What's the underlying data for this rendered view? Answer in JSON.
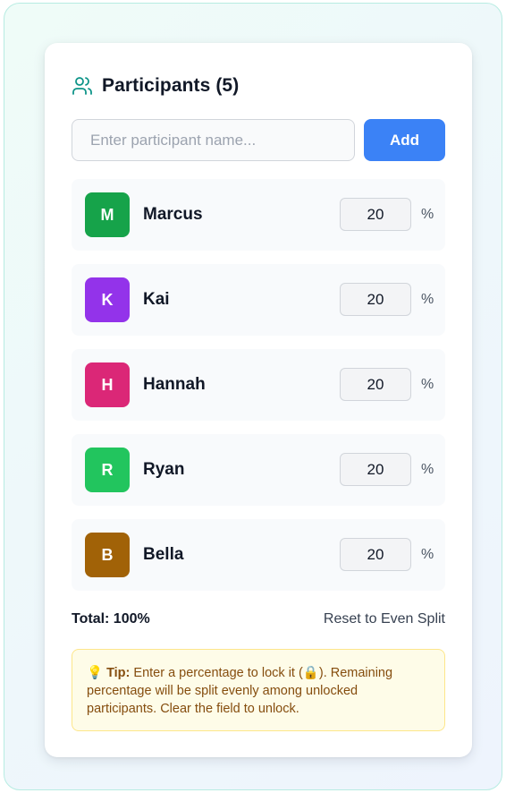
{
  "header": {
    "icon": "users-icon",
    "title": "Participants (5)"
  },
  "add_form": {
    "placeholder": "Enter participant name...",
    "value": "",
    "add_label": "Add"
  },
  "participants": [
    {
      "initial": "M",
      "name": "Marcus",
      "percent": "20",
      "unit": "%",
      "color": "#16a34a"
    },
    {
      "initial": "K",
      "name": "Kai",
      "percent": "20",
      "unit": "%",
      "color": "#9333ea"
    },
    {
      "initial": "H",
      "name": "Hannah",
      "percent": "20",
      "unit": "%",
      "color": "#db2777"
    },
    {
      "initial": "R",
      "name": "Ryan",
      "percent": "20",
      "unit": "%",
      "color": "#22c55e"
    },
    {
      "initial": "B",
      "name": "Bella",
      "percent": "20",
      "unit": "%",
      "color": "#a16207"
    }
  ],
  "summary": {
    "total_label": "Total: 100%",
    "reset_label": "Reset to Even Split"
  },
  "tip": {
    "icon": "lightbulb-icon",
    "label": "Tip:",
    "text": " Enter a percentage to lock it (🔒). Remaining percentage will be split evenly among unlocked participants. Clear the field to unlock."
  },
  "colors": {
    "accent": "#3b82f6",
    "header_icon": "#0d9488",
    "tip_background": "#fefce8",
    "tip_text": "#854d0e"
  }
}
